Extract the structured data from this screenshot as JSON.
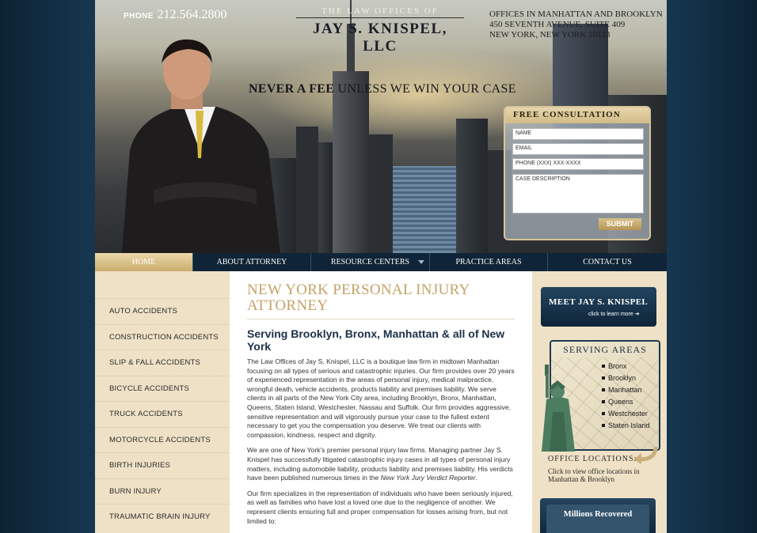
{
  "header": {
    "phone_label": "PHONE",
    "phone_number": "212.564.2800",
    "logo_line1": "THE LAW OFFICES OF",
    "logo_line2": "JAY S. KNISPEL, LLC",
    "offices": [
      "OFFICES IN MANHATTAN AND BROOKLYN",
      "450 SEVENTH AVENUE, SUITE 409",
      "NEW YORK, NEW YORK 10123"
    ],
    "tagline_bold": "NEVER A FEE",
    "tagline_rest": " UNLESS WE WIN YOUR CASE"
  },
  "consultation": {
    "title": "FREE  CONSULTATION",
    "name_placeholder": "NAME",
    "email_placeholder": "EMAIL",
    "phone_placeholder": "PHONE (XXX) XXX-XXXX",
    "case_placeholder": "CASE DESCRIPTION",
    "submit_label": "SUBMIT"
  },
  "nav": {
    "items": [
      "HOME",
      "ABOUT ATTORNEY",
      "RESOURCE CENTERS",
      "PRACTICE AREAS",
      "CONTACT US"
    ]
  },
  "sidebar": {
    "categories": [
      "AUTO ACCIDENTS",
      "CONSTRUCTION ACCIDENTS",
      "SLIP & FALL ACCIDENTS",
      "BICYCLE ACCIDENTS",
      "TRUCK ACCIDENTS",
      "MOTORCYCLE ACCIDENTS",
      "BIRTH INJURIES",
      "BURN INJURY",
      "TRAUMATIC BRAIN INJURY"
    ]
  },
  "main": {
    "title_line1": "NEW YORK PERSONAL INJURY",
    "title_line2": "ATTORNEY",
    "subtitle": "Serving Brooklyn, Bronx, Manhattan & all of New York",
    "p1": "The Law Offices of Jay S. Knispel, LLC is a boutique law firm in midtown Manhattan focusing on all types of serious and catastrophic injuries.  Our firm provides over 20 years of experienced representation in the areas of personal injury, medical malpractice, wrongful death, vehicle accidents, products liability and premises liability. We serve clients in all parts of the New York City area, including Brooklyn, Bronx, Manhattan, Queens, Staten Island, Westchester, Nassau and Suffolk.  Our firm provides aggressive, sensitive representation and will vigorously pursue your case to the fullest extent necessary to get you the compensation you deserve.  We treat our clients with compassion, kindness, respect and dignity.",
    "p2_text": "We are one of New York's premier personal injury law firms.  Managing partner Jay S. Knispel has successfully litigated catastrophic injury cases in all types of personal injury matters, including automobile liability, products liability and premises liability. His verdicts have been published numerous times in the ",
    "p2_em": "New York Jury Verdict Reporter",
    "p2_end": ".",
    "p3": "Our firm specializes in the representation of individuals who have been seriously injured, as well as families who have lost a loved one due to the negligence of another.  We represent clients ensuring full and proper compensation for losses arising from, but not limited to:"
  },
  "right": {
    "meet_title": "MEET JAY S. KNISPEL",
    "meet_sub": "click to learn more",
    "areas_title": "SERVING AREAS",
    "areas": [
      "Bronx",
      "Brooklyn",
      "Manhattan",
      "Queens",
      "Westchester",
      "Staten Island"
    ],
    "office_title": "OFFICE LOCATIONS:",
    "office_line1": "Click to view office locations in",
    "office_line2": "Manhattan & Brooklyn",
    "million_title": "Millions Recovered"
  }
}
